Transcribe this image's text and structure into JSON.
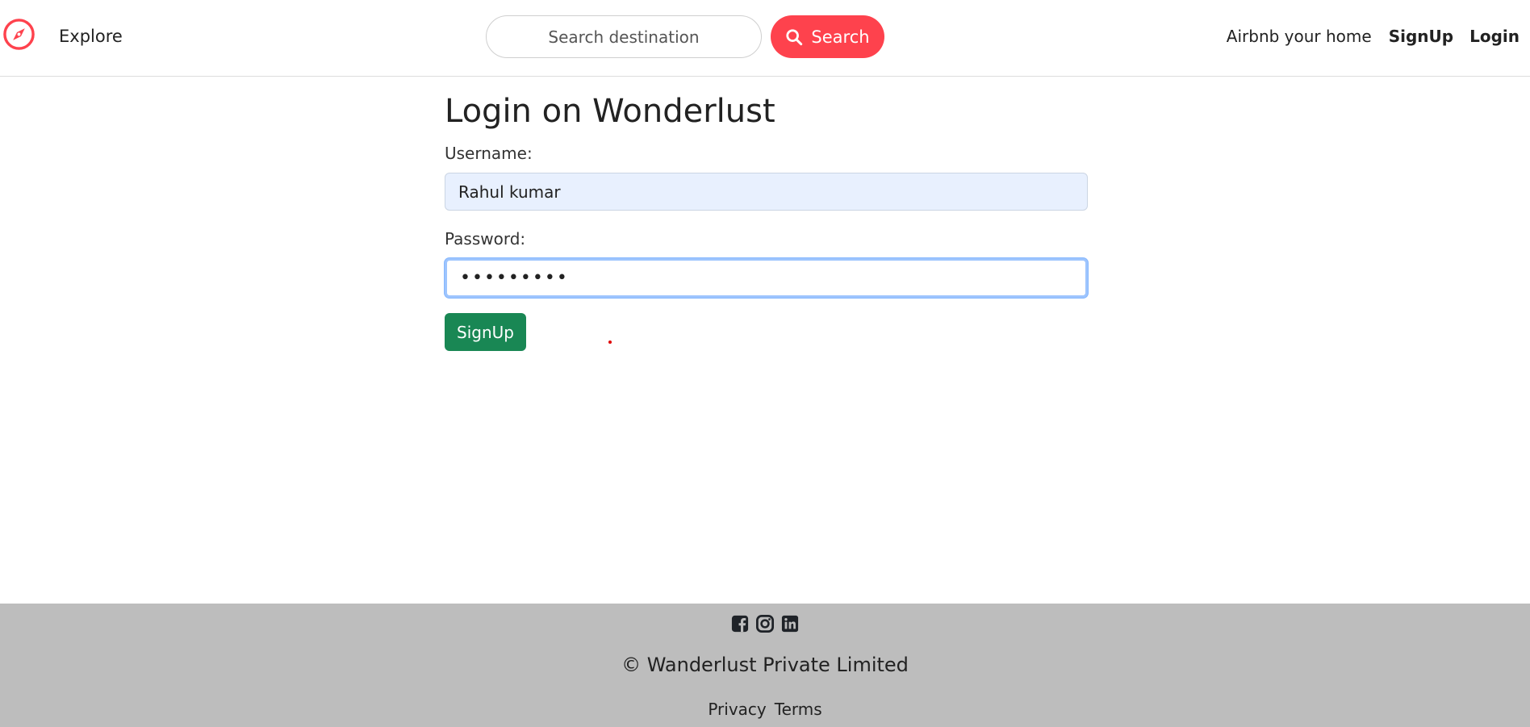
{
  "navbar": {
    "brand_icon": "compass-icon",
    "explore_label": "Explore",
    "search": {
      "placeholder": "Search destination",
      "button_label": "Search",
      "button_icon": "search-icon"
    },
    "links": {
      "host_label": "Airbnb your home",
      "signup_label": "SignUp",
      "login_label": "Login"
    }
  },
  "form": {
    "title": "Login on Wonderlust",
    "username_label": "Username:",
    "username_value": "Rahul kumar",
    "password_label": "Password:",
    "password_value": "•••••••••",
    "submit_label": "SignUp"
  },
  "footer": {
    "social_icons": [
      "facebook-icon",
      "instagram-icon",
      "linkedin-icon"
    ],
    "copyright": "© Wanderlust Private Limited",
    "links": [
      "Privacy",
      "Terms"
    ]
  },
  "colors": {
    "brand": "#fe424d",
    "submit": "#198754",
    "footer_bg": "#bdbdbd",
    "autofill_bg": "#e8f0fe"
  }
}
